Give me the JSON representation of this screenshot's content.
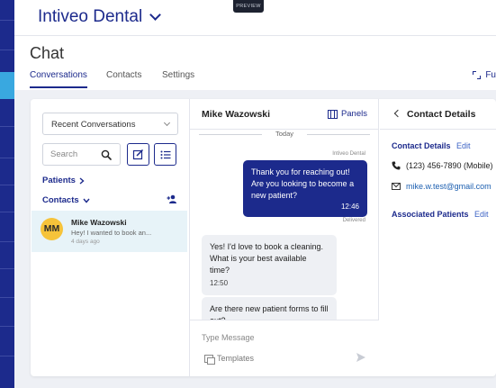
{
  "app": {
    "brand_name": "Intiveo Dental",
    "preview_tag": "PREVIEW",
    "accent_color": "#1c2a8c"
  },
  "page": {
    "title": "Chat",
    "tabs": [
      {
        "label": "Conversations",
        "active": true
      },
      {
        "label": "Contacts",
        "active": false
      },
      {
        "label": "Settings",
        "active": false
      }
    ],
    "fullscreen_label": "Fu"
  },
  "conversations_panel": {
    "dropdown_value": "Recent Conversations",
    "search_placeholder": "Search",
    "patients_label": "Patients",
    "contacts_label": "Contacts",
    "items": [
      {
        "initials": "MM",
        "name": "Mike Wazowski",
        "preview": "Hey! I wanted to book an...",
        "time": "4 days ago"
      }
    ]
  },
  "chat_panel": {
    "contact_name": "Mike Wazowski",
    "panels_label": "Panels",
    "day_divider": "Today",
    "messages": [
      {
        "direction": "out",
        "sender": "Intiveo Dental",
        "text": "Thank you for reaching out! Are you looking to become a new patient?",
        "time": "12:46",
        "status": "Delivered"
      },
      {
        "direction": "in",
        "text": "Yes! I'd love to book a cleaning. What is your best available time?",
        "time": "12:50"
      },
      {
        "direction": "in",
        "text": "Are there new patient forms to fill out?",
        "time": ""
      }
    ],
    "composer_placeholder": "Type Message",
    "templates_label": "Templates"
  },
  "details_panel": {
    "title": "Contact Details",
    "contact_section_label": "Contact Details",
    "edit_label": "Edit",
    "phone": "(123) 456-7890 (Mobile)",
    "email": "mike.w.test@gmail.com",
    "associated_patients_label": "Associated Patients",
    "associated_edit_label": "Edit"
  }
}
